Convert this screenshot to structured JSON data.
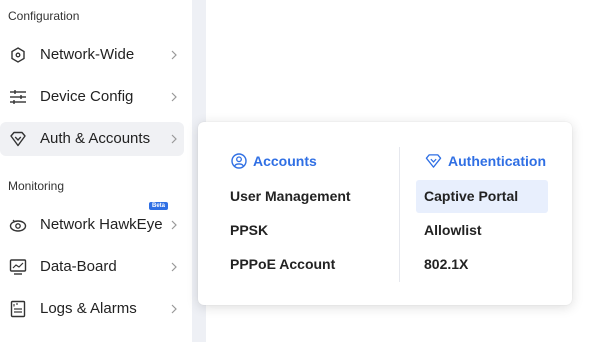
{
  "sidebar": {
    "sections": {
      "configuration": "Configuration",
      "monitoring": "Monitoring"
    },
    "items": [
      {
        "label": "Network-Wide",
        "icon": "hexagon-dot-icon"
      },
      {
        "label": "Device Config",
        "icon": "sliders-icon"
      },
      {
        "label": "Auth & Accounts",
        "icon": "shield-heart-icon",
        "active": true
      },
      {
        "label": "Network HawkEye",
        "icon": "eye-icon",
        "badge": "Beta"
      },
      {
        "label": "Data-Board",
        "icon": "chart-board-icon"
      },
      {
        "label": "Logs & Alarms",
        "icon": "log-file-icon"
      }
    ]
  },
  "popover": {
    "accounts": {
      "title": "Accounts",
      "icon": "user-circle-icon",
      "links": [
        "User Management",
        "PPSK",
        "PPPoE Account"
      ]
    },
    "authentication": {
      "title": "Authentication",
      "icon": "shield-heart-icon",
      "links": [
        "Captive Portal",
        "Allowlist",
        "802.1X"
      ],
      "selected": "Captive Portal"
    }
  },
  "colors": {
    "accent": "#2f6fe4",
    "selected_bg": "#e8effd",
    "active_nav_bg": "#f0f1f4",
    "strip": "#eef0f5"
  }
}
